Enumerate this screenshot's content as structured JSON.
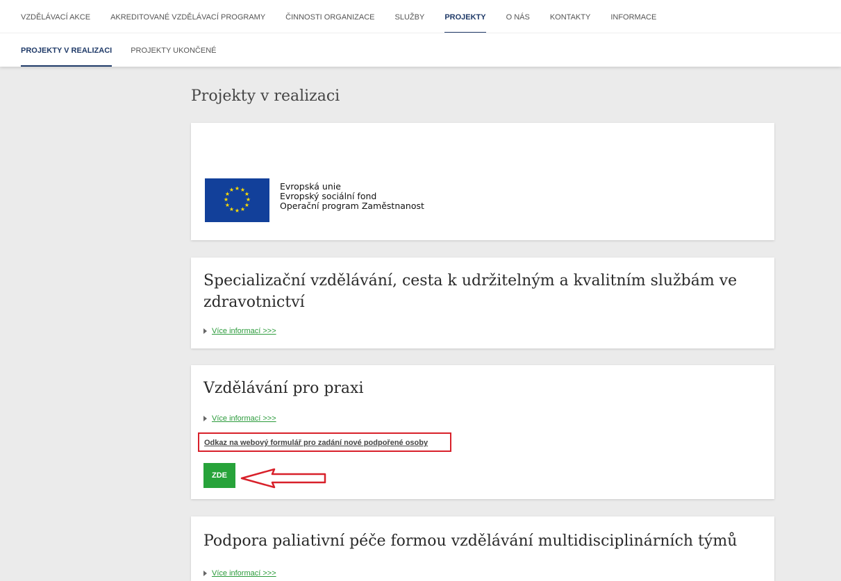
{
  "nav": {
    "main": [
      {
        "label": "VZDĚLÁVACÍ AKCE"
      },
      {
        "label": "AKREDITOVANÉ VZDĚLÁVACÍ PROGRAMY"
      },
      {
        "label": "ČINNOSTI ORGANIZACE"
      },
      {
        "label": "SLUŽBY"
      },
      {
        "label": "PROJEKTY",
        "active": true
      },
      {
        "label": "O NÁS"
      },
      {
        "label": "KONTAKTY"
      },
      {
        "label": "INFORMACE"
      }
    ],
    "sub": [
      {
        "label": "PROJEKTY V REALIZACI",
        "active": true
      },
      {
        "label": "PROJEKTY UKONČENÉ"
      }
    ]
  },
  "page": {
    "title": "Projekty v realizaci"
  },
  "eu_logo": {
    "lines": [
      "Evropská unie",
      "Evropský sociální fond",
      "Operační program Zaměstnanost"
    ]
  },
  "projects": [
    {
      "title": "Specializační vzdělávání, cesta k udržitelným a kvalitním službám ve zdravotnictví",
      "more_link": "Více informací >>>"
    },
    {
      "title": "Vzdělávání pro praxi",
      "more_link": "Více informací >>>",
      "form_link": "Odkaz na webový formulář pro zadání nové podpořené osoby",
      "button": "ZDE"
    },
    {
      "title": "Podpora paliativní péče formou vzdělávání multidisciplinárních týmů",
      "more_link": "Více informací >>>"
    }
  ],
  "colors": {
    "accent": "#1f3a68",
    "link": "#2a9a3a",
    "button": "#27a33a",
    "highlight": "#d8202a",
    "eu_blue": "#12409a",
    "eu_star": "#ffdd00"
  },
  "icons": [
    "triangle-right-icon",
    "eu-flag-icon",
    "red-arrow-icon"
  ]
}
